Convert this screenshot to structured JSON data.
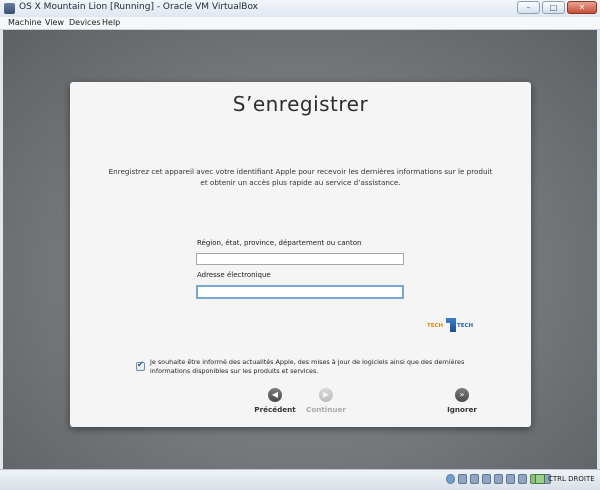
{
  "window": {
    "title": "OS X Mountain Lion [Running] - Oracle VM VirtualBox",
    "buttons": {
      "minimize": "–",
      "maximize": "□",
      "close": "✕"
    }
  },
  "menu": [
    "Machine",
    "View",
    "Devices",
    "Help"
  ],
  "setup": {
    "title": "S’enregistrer",
    "description_line1": "Enregistrez cet appareil avec votre identifiant Apple pour recevoir les dernières informations sur le produit",
    "description_line2": "et obtenir un accès plus rapide au service d’assistance.",
    "region_label": "Région, état, province, département ou canton",
    "region_value": "",
    "email_label": "Adresse électronique",
    "email_value": "",
    "checkbox_checked": true,
    "checkbox_text": "Je souhaite être informé des actualités Apple, des mises à jour de logiciels ainsi que des dernières informations disponibles sur les produits et services.",
    "back_label": "Précédent",
    "continue_label": "Continuer",
    "skip_label": "Ignorer"
  },
  "watermark": {
    "left": "TECH",
    "right": "TECH"
  },
  "status": {
    "host_key": "CTRL DROITE"
  },
  "colors": {
    "panel": "#f5f5f5",
    "guest_bg": "#74787b",
    "focus_ring": "#7aa7d6"
  }
}
